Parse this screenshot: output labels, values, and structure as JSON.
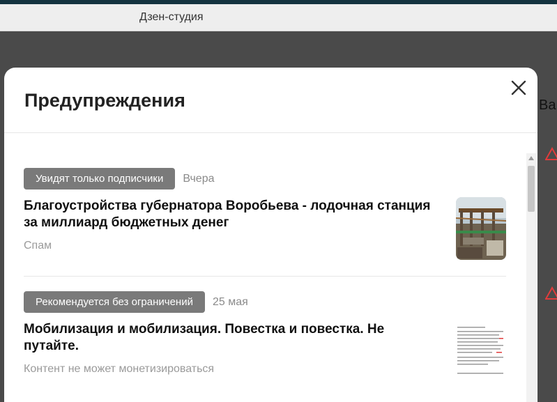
{
  "window": {
    "tab_title": "Дзен-студия"
  },
  "background": {
    "partial_text": "Ва"
  },
  "modal": {
    "title": "Предупреждения",
    "close_icon": "close-icon",
    "items": [
      {
        "badge": "Увидят только подписчики",
        "date": "Вчера",
        "title": "Благоустройства губернатора Воробьева - лодочная станция за миллиард бюджетных денег",
        "reason": "Спам",
        "thumbnail": "construction-photo"
      },
      {
        "badge": "Рекомендуется без ограничений",
        "date": "25 мая",
        "title": "Мобилизация и мобилизация. Повестка и повестка. Не путайте.",
        "reason": "Контент не может монетизироваться",
        "thumbnail": "text-document-preview"
      }
    ]
  },
  "colors": {
    "overlay": "#4a4a4a",
    "badge_bg": "#7a7a7a",
    "warning_red": "#e23b3b",
    "top_bar": "#14333f"
  }
}
